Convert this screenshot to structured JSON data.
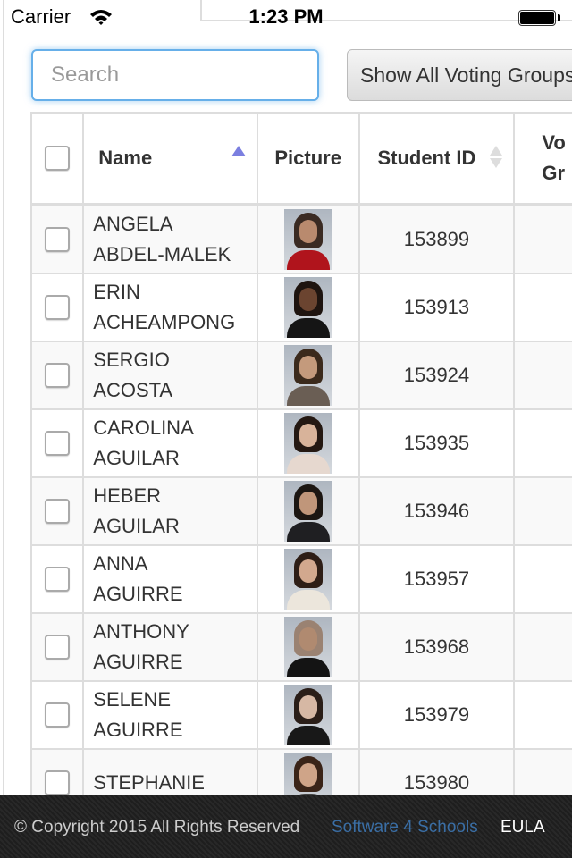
{
  "status_bar": {
    "carrier": "Carrier",
    "time": "1:23 PM",
    "battery_level": 1.0
  },
  "search": {
    "placeholder": "Search",
    "value": ""
  },
  "voting_button": {
    "label": "Show All Voting Groups"
  },
  "table": {
    "columns": [
      "Name",
      "Picture",
      "Student ID",
      "Voting Group"
    ],
    "voting_group_lines": [
      "Vo",
      "Gr"
    ],
    "sort": {
      "column": "Name",
      "direction": "ascending"
    },
    "rows": [
      {
        "first": "ANGELA",
        "last": "ABDEL-MALEK",
        "id": "153899",
        "photo": {
          "hair": "#3a2a22",
          "face": "#b98a6e",
          "body": "#b0141c"
        }
      },
      {
        "first": "ERIN",
        "last": "ACHEAMPONG",
        "id": "153913",
        "photo": {
          "hair": "#1e1410",
          "face": "#6b4430",
          "body": "#151515"
        }
      },
      {
        "first": "SERGIO",
        "last": "ACOSTA",
        "id": "153924",
        "photo": {
          "hair": "#3b2a1c",
          "face": "#c49a7c",
          "body": "#6a5e54"
        }
      },
      {
        "first": "CAROLINA",
        "last": "AGUILAR",
        "id": "153935",
        "photo": {
          "hair": "#241812",
          "face": "#d8b39a",
          "body": "#e6d8cf"
        }
      },
      {
        "first": "HEBER",
        "last": "AGUILAR",
        "id": "153946",
        "photo": {
          "hair": "#1c1612",
          "face": "#c0967a",
          "body": "#1f1f22"
        }
      },
      {
        "first": "ANNA",
        "last": "AGUIRRE",
        "id": "153957",
        "photo": {
          "hair": "#2e1e16",
          "face": "#d2a88e",
          "body": "#ece6dc"
        }
      },
      {
        "first": "ANTHONY",
        "last": "AGUIRRE",
        "id": "153968",
        "photo": {
          "hair": "#9a8272",
          "face": "#b08a70",
          "body": "#141414"
        }
      },
      {
        "first": "SELENE",
        "last": "AGUIRRE",
        "id": "153979",
        "photo": {
          "hair": "#2a1e18",
          "face": "#d6b8a4",
          "body": "#181818"
        }
      },
      {
        "first": "STEPHANIE",
        "last": "",
        "id": "153980",
        "photo": {
          "hair": "#3a2418",
          "face": "#cfa488",
          "body": "#444"
        }
      }
    ]
  },
  "footer": {
    "copyright": "© Copyright 2015 All Rights Reserved",
    "link_label": "Software 4 Schools",
    "eula_label": "EULA",
    "link_color": "#3a6ea5"
  }
}
